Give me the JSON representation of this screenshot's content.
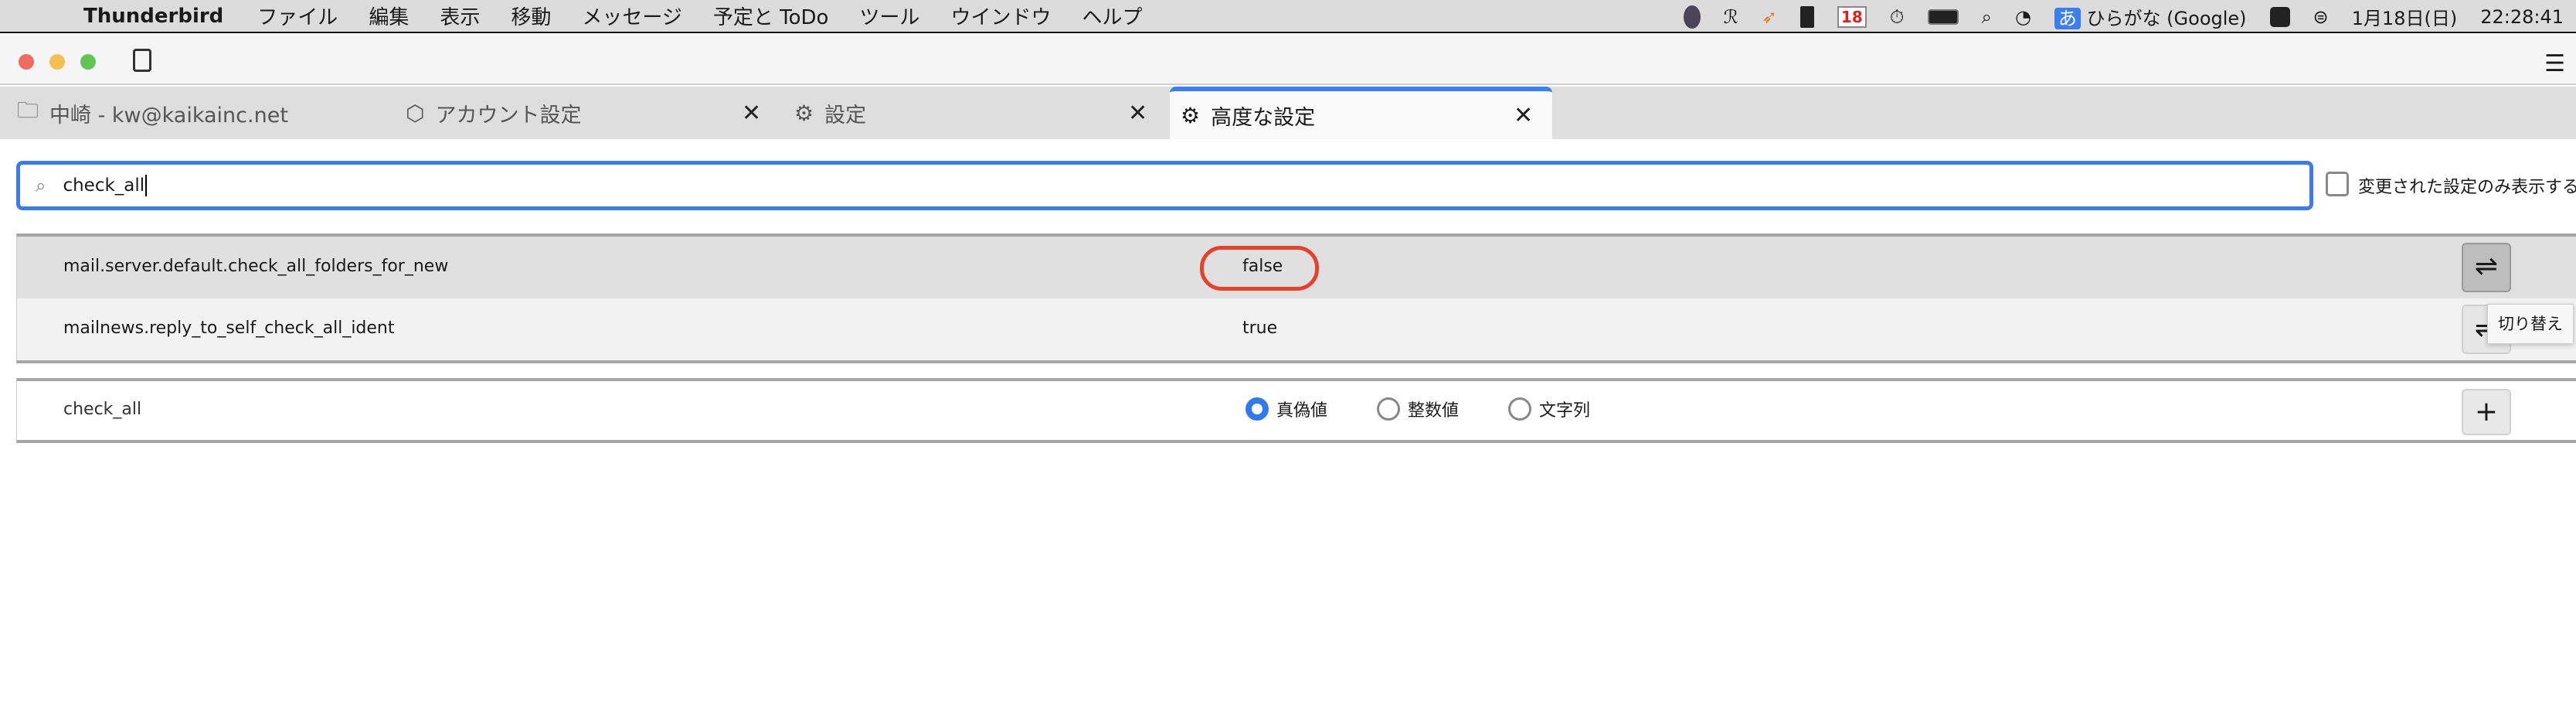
{
  "menubar": {
    "app": "Thunderbird",
    "items": [
      "ファイル",
      "編集",
      "表示",
      "移動",
      "メッセージ",
      "予定と ToDo",
      "ツール",
      "ウインドウ",
      "ヘルプ"
    ],
    "status": {
      "calendar_day": "18",
      "ime_glyph": "あ",
      "ime_label": "ひらがな (Google)",
      "date": "1月18日(日)",
      "time": "22:28:41"
    }
  },
  "tabs": [
    {
      "label": "中崎 - kw@kaikainc.net",
      "icon": "folder-icon"
    },
    {
      "label": "アカウント設定",
      "icon": "account-icon"
    },
    {
      "label": "設定",
      "icon": "gear-icon"
    },
    {
      "label": "高度な設定",
      "icon": "gear-icon",
      "active": true
    }
  ],
  "search": {
    "value": "check_all"
  },
  "show_modified_label": "変更された設定のみ表示する",
  "prefs": [
    {
      "name": "mail.server.default.check_all_folders_for_new",
      "value": "false"
    },
    {
      "name": "mailnews.reply_to_self_check_all_ident",
      "value": "true"
    }
  ],
  "tooltip": "切り替え",
  "add_row": {
    "name": "check_all",
    "types": [
      "真偽値",
      "整数値",
      "文字列"
    ],
    "selected": "真偽値"
  },
  "colors": {
    "accent": "#3a7bf0",
    "highlight_ring": "#e8412a"
  }
}
